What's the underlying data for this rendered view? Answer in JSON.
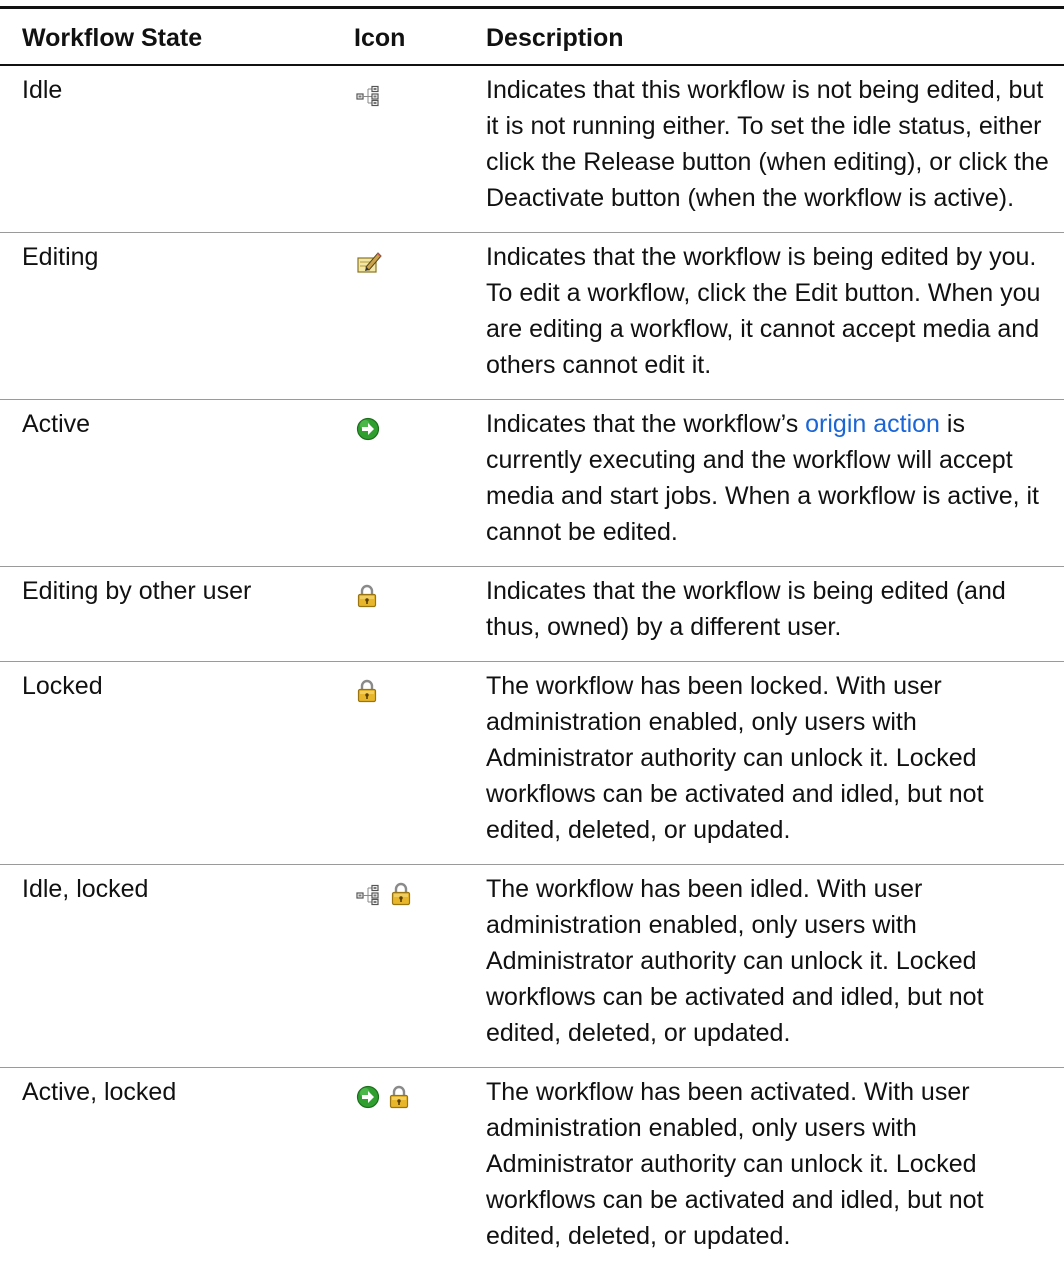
{
  "table": {
    "headers": {
      "state": "Workflow State",
      "icon": "Icon",
      "description": "Description"
    },
    "rows": [
      {
        "state": "Idle",
        "icons": [
          "workflow-idle-icon"
        ],
        "description": "Indicates that this workflow is not being edited, but it is not running either. To set the idle status, either click the Release button (when editing), or click the Deactivate button (when the workflow is active)."
      },
      {
        "state": "Editing",
        "icons": [
          "edit-pencil-icon"
        ],
        "description": "Indicates that the workflow is being edited by you. To edit a workflow, click the Edit button. When you are editing a workflow, it cannot accept media and others cannot edit it."
      },
      {
        "state": "Active",
        "icons": [
          "green-arrow-icon"
        ],
        "description_before": "Indicates that the workflow’s ",
        "description_link": "origin action",
        "description_after": " is currently executing and the workflow will accept media and start jobs. When a workflow is active, it cannot be edited."
      },
      {
        "state": "Editing by other user",
        "icons": [
          "padlock-icon"
        ],
        "description": "Indicates that the workflow is being edited (and thus, owned) by a different user."
      },
      {
        "state": "Locked",
        "icons": [
          "padlock-icon"
        ],
        "description": "The workflow has been locked. With user administration enabled, only users with Administrator authority can unlock it. Locked workflows can be activated and idled, but not edited, deleted, or updated."
      },
      {
        "state": "Idle, locked",
        "icons": [
          "workflow-idle-icon",
          "padlock-icon"
        ],
        "description": "The workflow has been idled. With user administration enabled, only users with Administrator authority can unlock it. Locked workflows can be activated and idled, but not edited, deleted, or updated."
      },
      {
        "state": "Active, locked",
        "icons": [
          "green-arrow-icon",
          "padlock-icon"
        ],
        "description": "The workflow has been activated. With user administration enabled, only users with Administrator authority can unlock it. Locked workflows can be activated and idled, but not edited, deleted, or updated."
      }
    ]
  },
  "colors": {
    "link": "#1a66d6",
    "lock": "#e8b62a",
    "arrow": "#2fa02f"
  }
}
